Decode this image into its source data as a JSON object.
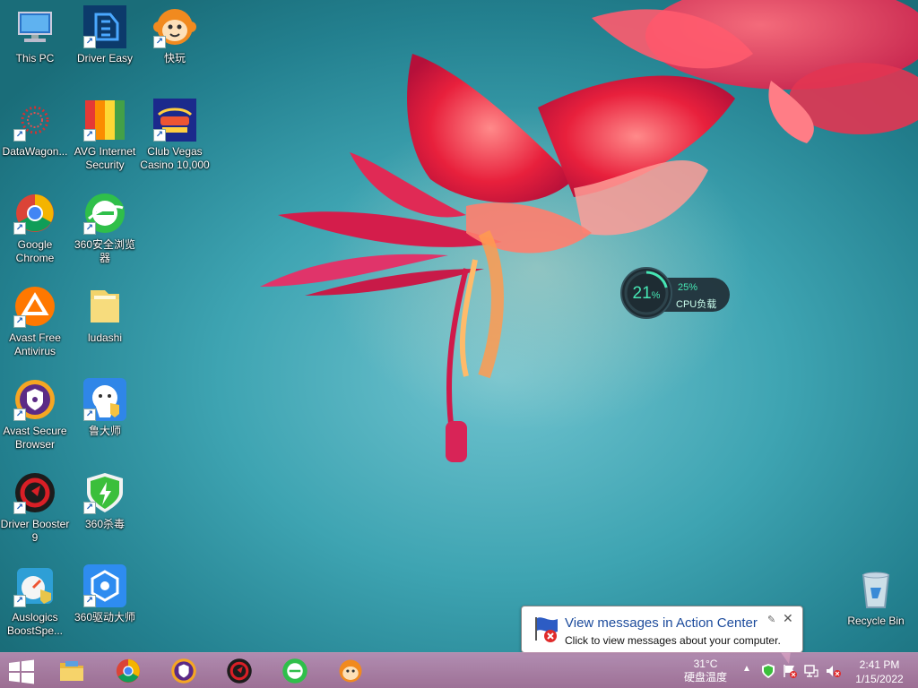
{
  "desktop": {
    "icons": [
      {
        "label": "This PC",
        "icon": "this-pc-icon"
      },
      {
        "label": "Driver Easy",
        "icon": "driver-easy-icon"
      },
      {
        "label": "快玩",
        "icon": "kuaiwan-monkey-icon"
      },
      {
        "label": "DataWagon...",
        "icon": "datawagon-icon"
      },
      {
        "label": "AVG Internet Security",
        "icon": "avg-icon"
      },
      {
        "label": "Club Vegas Casino 10,000",
        "icon": "club-vegas-icon"
      },
      {
        "label": "Google Chrome",
        "icon": "chrome-icon"
      },
      {
        "label": "360安全浏览器",
        "icon": "360-browser-icon"
      },
      {
        "label": "Avast Free Antivirus",
        "icon": "avast-icon"
      },
      {
        "label": "ludashi",
        "icon": "folder-icon"
      },
      {
        "label": "Avast Secure Browser",
        "icon": "avast-browser-icon"
      },
      {
        "label": "鲁大师",
        "icon": "ludashi-icon"
      },
      {
        "label": "Driver Booster 9",
        "icon": "driver-booster-icon"
      },
      {
        "label": "360杀毒",
        "icon": "360-antivirus-icon"
      },
      {
        "label": "Auslogics BoostSpe...",
        "icon": "auslogics-icon"
      },
      {
        "label": "360驱动大师",
        "icon": "360-driver-icon"
      }
    ],
    "recycle_bin": {
      "label": "Recycle Bin",
      "icon": "recycle-bin-icon"
    },
    "cpu_widget": {
      "value": "21",
      "unit": "%",
      "load_percent": "25%",
      "load_label": "CPU负载"
    }
  },
  "notification": {
    "title": "View messages in Action Center",
    "text": "Click to view messages about your computer.",
    "close": "✕",
    "pin": "✎"
  },
  "taskbar": {
    "apps": [
      "file-explorer-icon",
      "chrome-icon",
      "avast-browser-icon",
      "driver-booster-icon",
      "360-browser-icon",
      "kuaiwan-monkey-icon"
    ],
    "tray": {
      "temp": "31°C",
      "temp_label": "硬盘温度",
      "show_hidden": "▲",
      "time": "2:41 PM",
      "date": "1/15/2022"
    }
  },
  "colors": {
    "accent": "#46e6b4",
    "taskbar": "#b57ea0"
  }
}
